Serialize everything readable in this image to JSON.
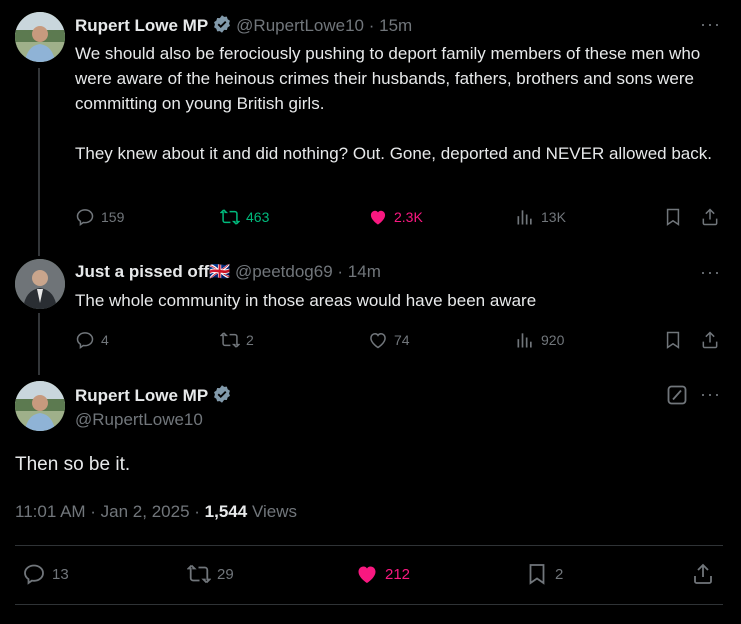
{
  "tweet1": {
    "name": "Rupert Lowe MP",
    "handle": "@RupertLowe10",
    "time": "· 15m",
    "text_p1": "We should also be ferociously pushing to deport family members of these men who were aware of the heinous crimes their husbands, fathers, brothers and sons were committing on young British girls.",
    "text_p2": "They knew about it and did nothing? Out. Gone, deported and NEVER allowed back.",
    "replies": "159",
    "reposts": "463",
    "likes": "2.3K",
    "views": "13K"
  },
  "tweet2": {
    "name": "Just a pissed off",
    "flag": "🇬🇧",
    "handle": "@peetdog69",
    "time": "· 14m",
    "text": "The whole community in those areas would have been aware",
    "replies": "4",
    "reposts": "2",
    "likes": "74",
    "views": "920"
  },
  "main": {
    "name": "Rupert Lowe MP",
    "handle": "@RupertLowe10",
    "text": "Then so be it.",
    "timestamp": "11:01 AM · Jan 2, 2025 ·",
    "views_count": "1,544",
    "views_label": "Views",
    "replies": "13",
    "reposts": "29",
    "likes": "212",
    "bookmarks": "2"
  },
  "colors": {
    "background": "#000000",
    "text": "#e7e9ea",
    "muted": "#71767b",
    "repost_active": "#00ba7c",
    "like_active": "#f91880",
    "verified": "#829aab"
  },
  "more_glyph": "···"
}
